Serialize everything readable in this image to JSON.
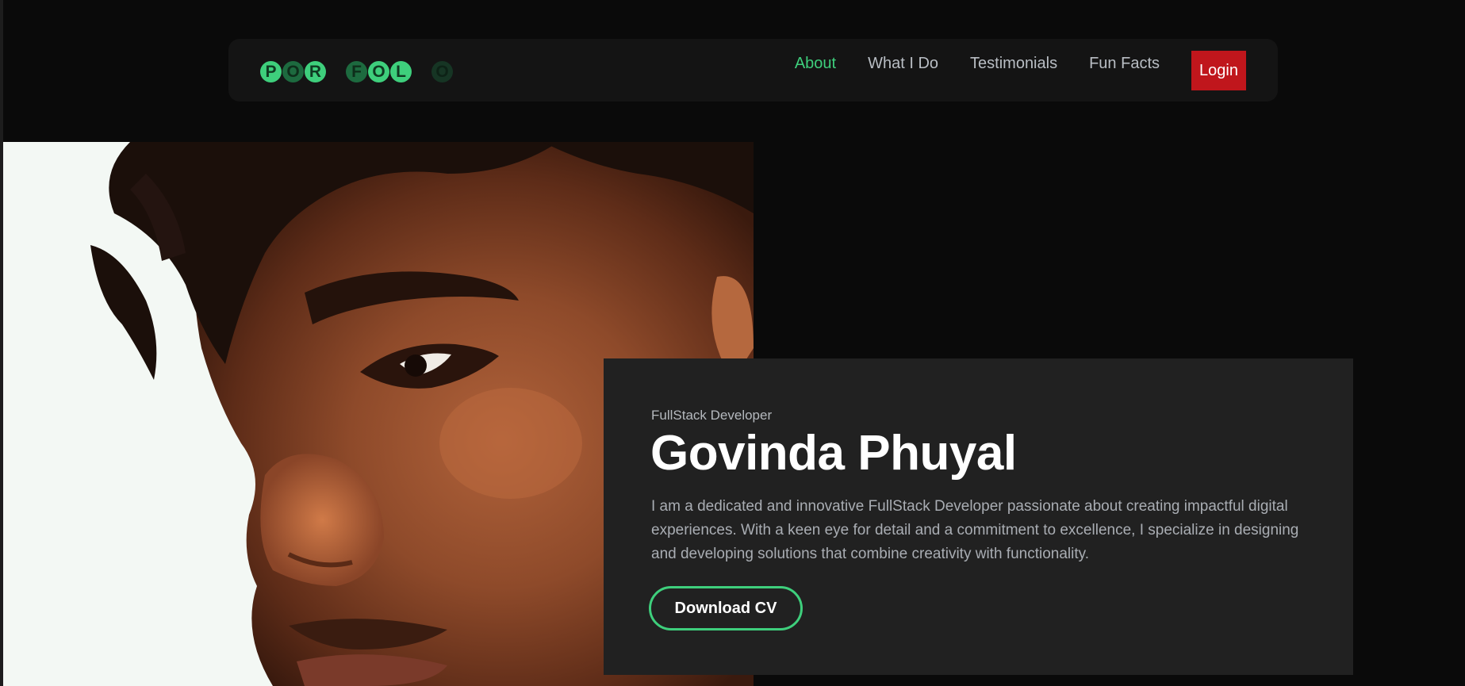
{
  "navbar": {
    "logo_letters": [
      "P",
      "O",
      "R",
      "F",
      "O",
      "L",
      "O"
    ],
    "links": [
      "About",
      "What I Do",
      "Testimonials",
      "Fun Facts"
    ],
    "active_link": "About",
    "login_label": "Login"
  },
  "hero": {
    "subtitle": "FullStack Developer",
    "name": "Govinda Phuyal",
    "bio": "I am a dedicated and innovative FullStack Developer passionate about creating impactful digital experiences. With a keen eye for detail and a commitment to excellence, I specialize in designing and developing solutions that combine creativity with functionality.",
    "cv_button": "Download CV"
  },
  "colors": {
    "accent": "#3ecf7c",
    "login": "#c0161c",
    "background": "#0a0a0a",
    "card": "#212121",
    "navbar": "#141414"
  }
}
